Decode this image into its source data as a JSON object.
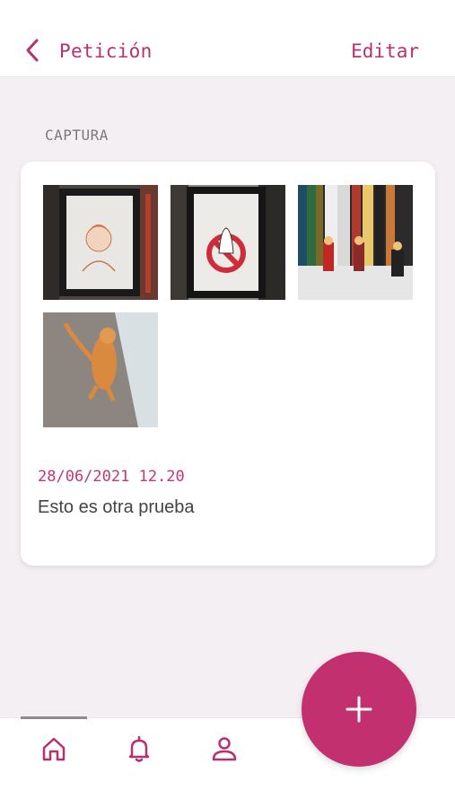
{
  "header": {
    "back_icon": "chevron-left-icon",
    "title": "Petición",
    "edit_label": "Editar"
  },
  "section": {
    "label": "CAPTURA"
  },
  "entry": {
    "photos": [
      {
        "name": "photo-portrait-drawing"
      },
      {
        "name": "photo-ghostbusters-frame"
      },
      {
        "name": "photo-figures-shelf"
      },
      {
        "name": "photo-cat"
      }
    ],
    "date": "28/06/2021 12.20",
    "description": "Esto es otra prueba"
  },
  "bottom_nav": {
    "items": [
      {
        "icon": "home-icon",
        "active": true
      },
      {
        "icon": "bell-icon",
        "active": false
      },
      {
        "icon": "user-icon",
        "active": false
      }
    ]
  },
  "fab": {
    "icon": "plus-icon"
  },
  "colors": {
    "accent": "#c2306f",
    "background": "#f3eff3",
    "card": "#ffffff"
  }
}
